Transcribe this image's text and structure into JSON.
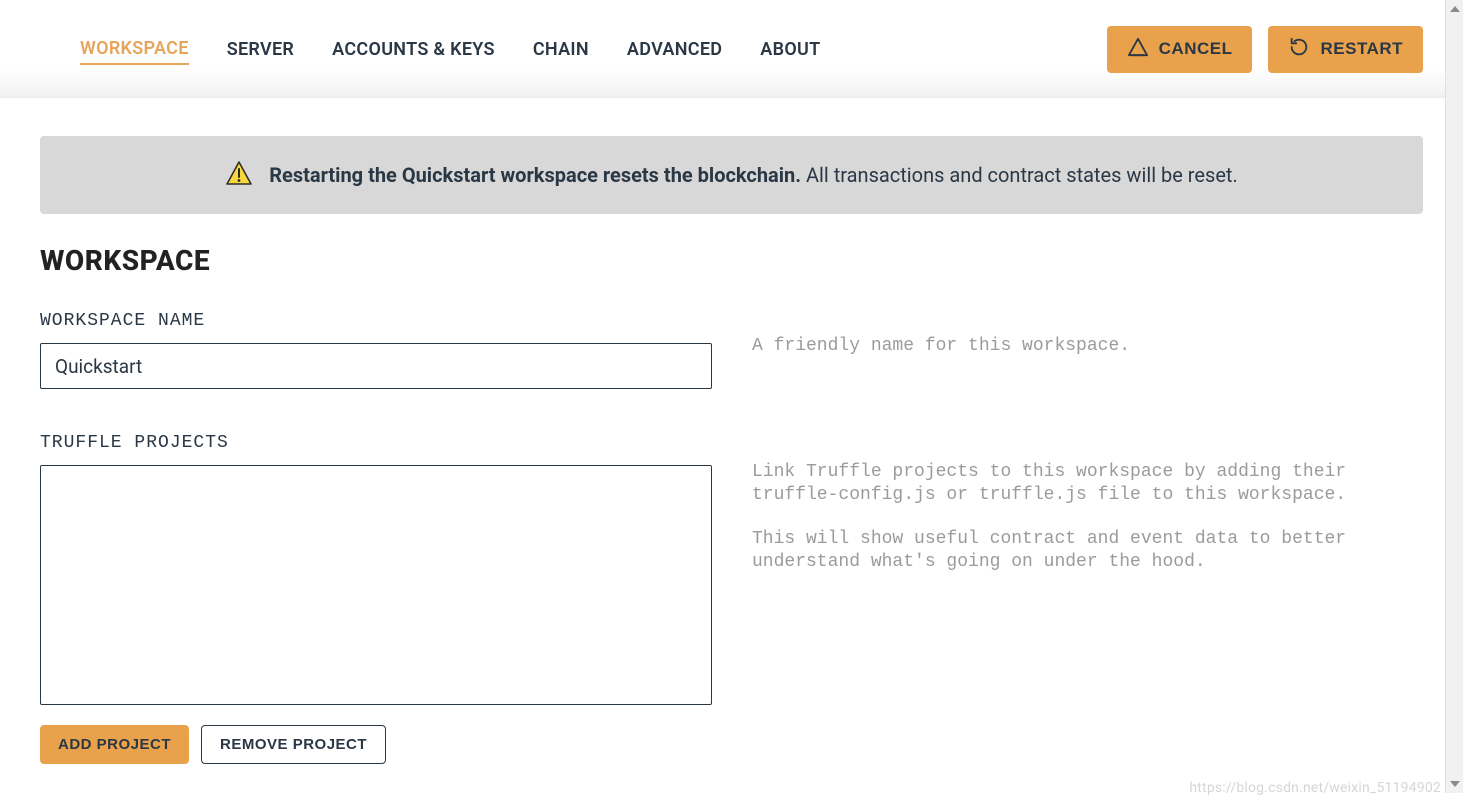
{
  "tabs": [
    {
      "label": "WORKSPACE",
      "active": true
    },
    {
      "label": "SERVER",
      "active": false
    },
    {
      "label": "ACCOUNTS & KEYS",
      "active": false
    },
    {
      "label": "CHAIN",
      "active": false
    },
    {
      "label": "ADVANCED",
      "active": false
    },
    {
      "label": "ABOUT",
      "active": false
    }
  ],
  "headerActions": {
    "cancel": "CANCEL",
    "restart": "RESTART"
  },
  "notice": {
    "bold": "Restarting the Quickstart workspace resets the blockchain.",
    "rest": " All transactions and contract states will be reset."
  },
  "section": {
    "title": "WORKSPACE"
  },
  "fields": {
    "workspaceName": {
      "label": "WORKSPACE NAME",
      "value": "Quickstart",
      "helper": "A friendly name for this workspace."
    },
    "truffleProjects": {
      "label": "TRUFFLE PROJECTS",
      "helper1": "Link Truffle projects to this workspace by adding their truffle-config.js or truffle.js file to this workspace.",
      "helper2": "This will show useful contract and event data to better understand what's going on under the hood."
    }
  },
  "buttons": {
    "addProject": "ADD PROJECT",
    "removeProject": "REMOVE PROJECT"
  },
  "watermark": "https://blog.csdn.net/weixin_51194902"
}
